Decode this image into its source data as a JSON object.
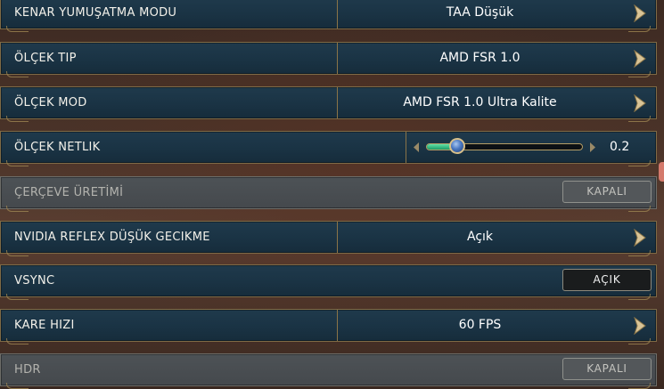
{
  "rows": [
    {
      "label": "KENAR YUMUŞATMA MODU",
      "value": "TAA Düşük"
    },
    {
      "label": "ÖLÇEK TIP",
      "value": "AMD FSR 1.0"
    },
    {
      "label": "ÖLÇEK MOD",
      "value": "AMD FSR 1.0 Ultra Kalite"
    },
    {
      "label": "ÖLÇEK NETLIK",
      "value": "0.2",
      "slider_fraction": 0.2
    },
    {
      "label": "ÇERÇEVE ÜRETİMİ",
      "toggle": "KAPALI",
      "disabled": true
    },
    {
      "label": "NVIDIA REFLEX DÜŞÜK GECIKME",
      "value": "Açık"
    },
    {
      "label": "VSYNC",
      "toggle": "AÇIK"
    },
    {
      "label": "KARE HIZI",
      "value": "60 FPS"
    },
    {
      "label": "HDR",
      "toggle": "KAPALI",
      "disabled": true
    }
  ],
  "icons": {
    "selector_arrow": "chevron-right-icon",
    "slider_left": "triangle-left-icon",
    "slider_right": "triangle-right-icon"
  },
  "colors": {
    "row_bg": "#1d3647",
    "row_border": "#7f6a45",
    "disabled_bg": "#4b5054",
    "slider_fill": "#3fcf8f",
    "knob": "#4a78c2"
  }
}
